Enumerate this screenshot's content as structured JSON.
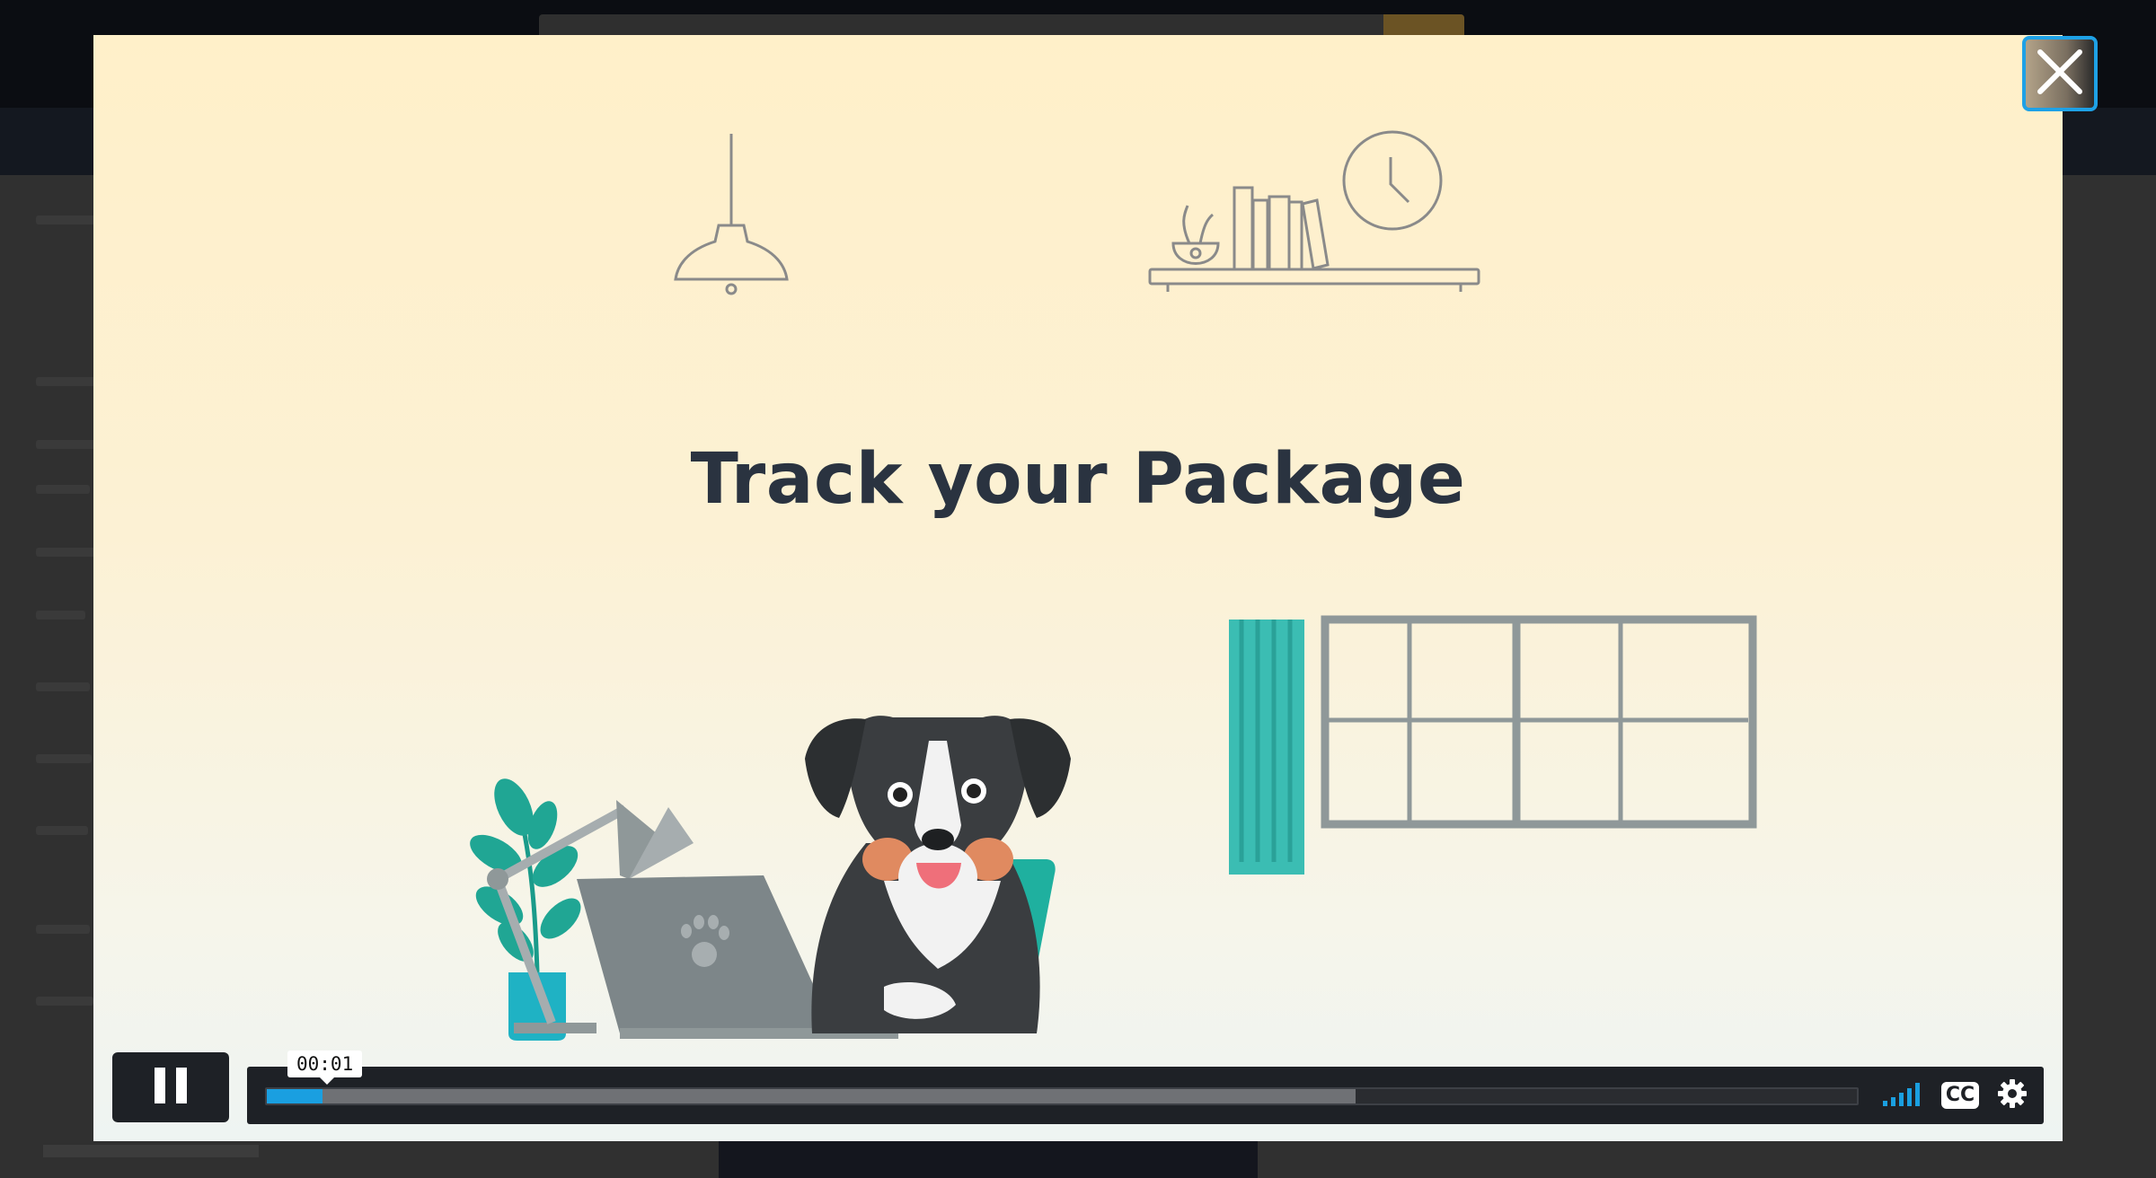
{
  "modal": {
    "title": "Track your Package"
  },
  "player": {
    "current_time": "00:01",
    "played_fraction": 0.035,
    "buffered_fraction": 0.685,
    "accent_color": "#1a9fe0",
    "controls": {
      "pause_icon": "pause-icon",
      "volume_icon": "volume-bars-icon",
      "captions_label": "CC",
      "settings_icon": "gear-icon"
    }
  },
  "close": {
    "icon": "close-x-icon",
    "accent_color": "#1ea1e6"
  }
}
